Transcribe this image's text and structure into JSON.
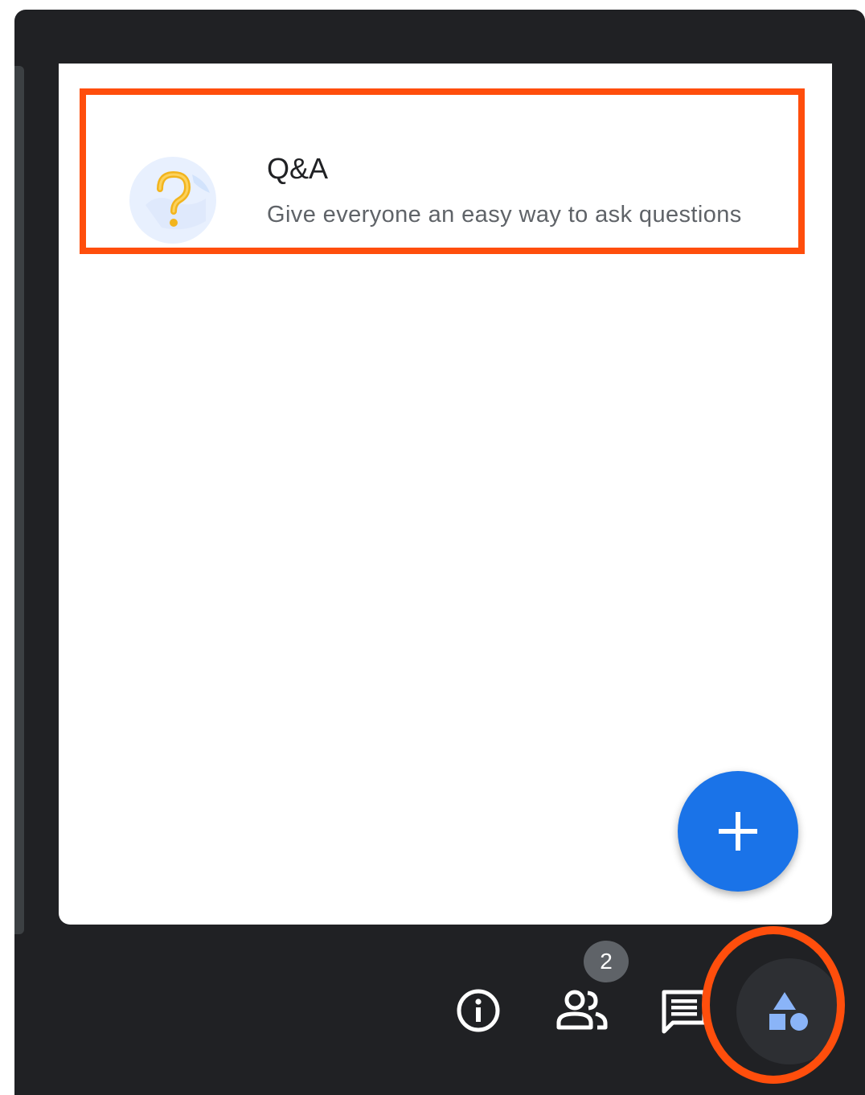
{
  "activity_item": {
    "title": "Q&A",
    "description": "Give everyone an easy way to ask questions",
    "icon": "question-mark-icon"
  },
  "fab": {
    "icon": "plus-icon"
  },
  "toolbar": {
    "info_icon": "info-icon",
    "people_icon": "people-icon",
    "people_badge": "2",
    "chat_icon": "chat-icon",
    "activities_icon": "activities-shapes-icon"
  },
  "colors": {
    "frame_bg": "#202124",
    "panel_bg": "#ffffff",
    "accent_blue": "#1a73e8",
    "highlight": "#ff4e0c",
    "activities_icon": "#8ab4f8"
  }
}
